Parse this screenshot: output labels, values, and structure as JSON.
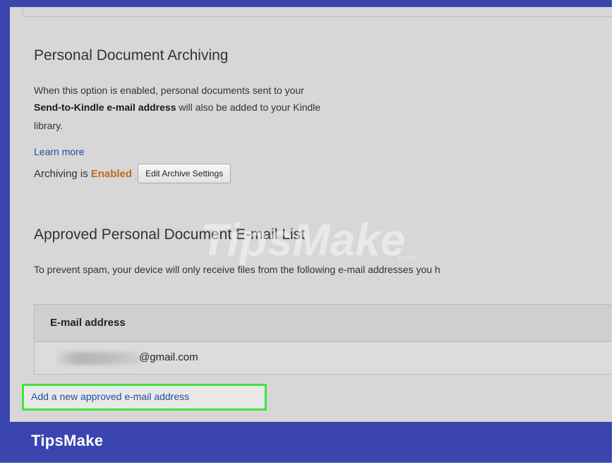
{
  "personal_document_archiving": {
    "title": "Personal Document Archiving",
    "description_line1": "When this option is enabled, personal documents sent to your",
    "description_bold": "Send-to-Kindle e-mail address",
    "description_line2_rest": " will also be added to your Kindle",
    "description_line3": "library.",
    "learn_more": "Learn more",
    "status_prefix": "Archiving is",
    "status_value": "Enabled",
    "edit_button_label": "Edit Archive Settings"
  },
  "approved_list": {
    "title": "Approved Personal Document E-mail List",
    "note": "To prevent spam, your device will only receive files from the following e-mail addresses you h",
    "column_header": "E-mail address",
    "rows": [
      {
        "email_visible_part": "@gmail.com"
      }
    ],
    "add_link": "Add a new approved e-mail address"
  },
  "watermark": {
    "text": "TipsMake",
    "suffix": ".com"
  },
  "footer": {
    "brand": "TipsMake"
  },
  "colors": {
    "frame": "#3a45b0",
    "screen_bg": "#d7d7d7",
    "link": "#1f4fa0",
    "enabled_status": "#c46a1c",
    "highlight_border": "#3ee53a"
  }
}
